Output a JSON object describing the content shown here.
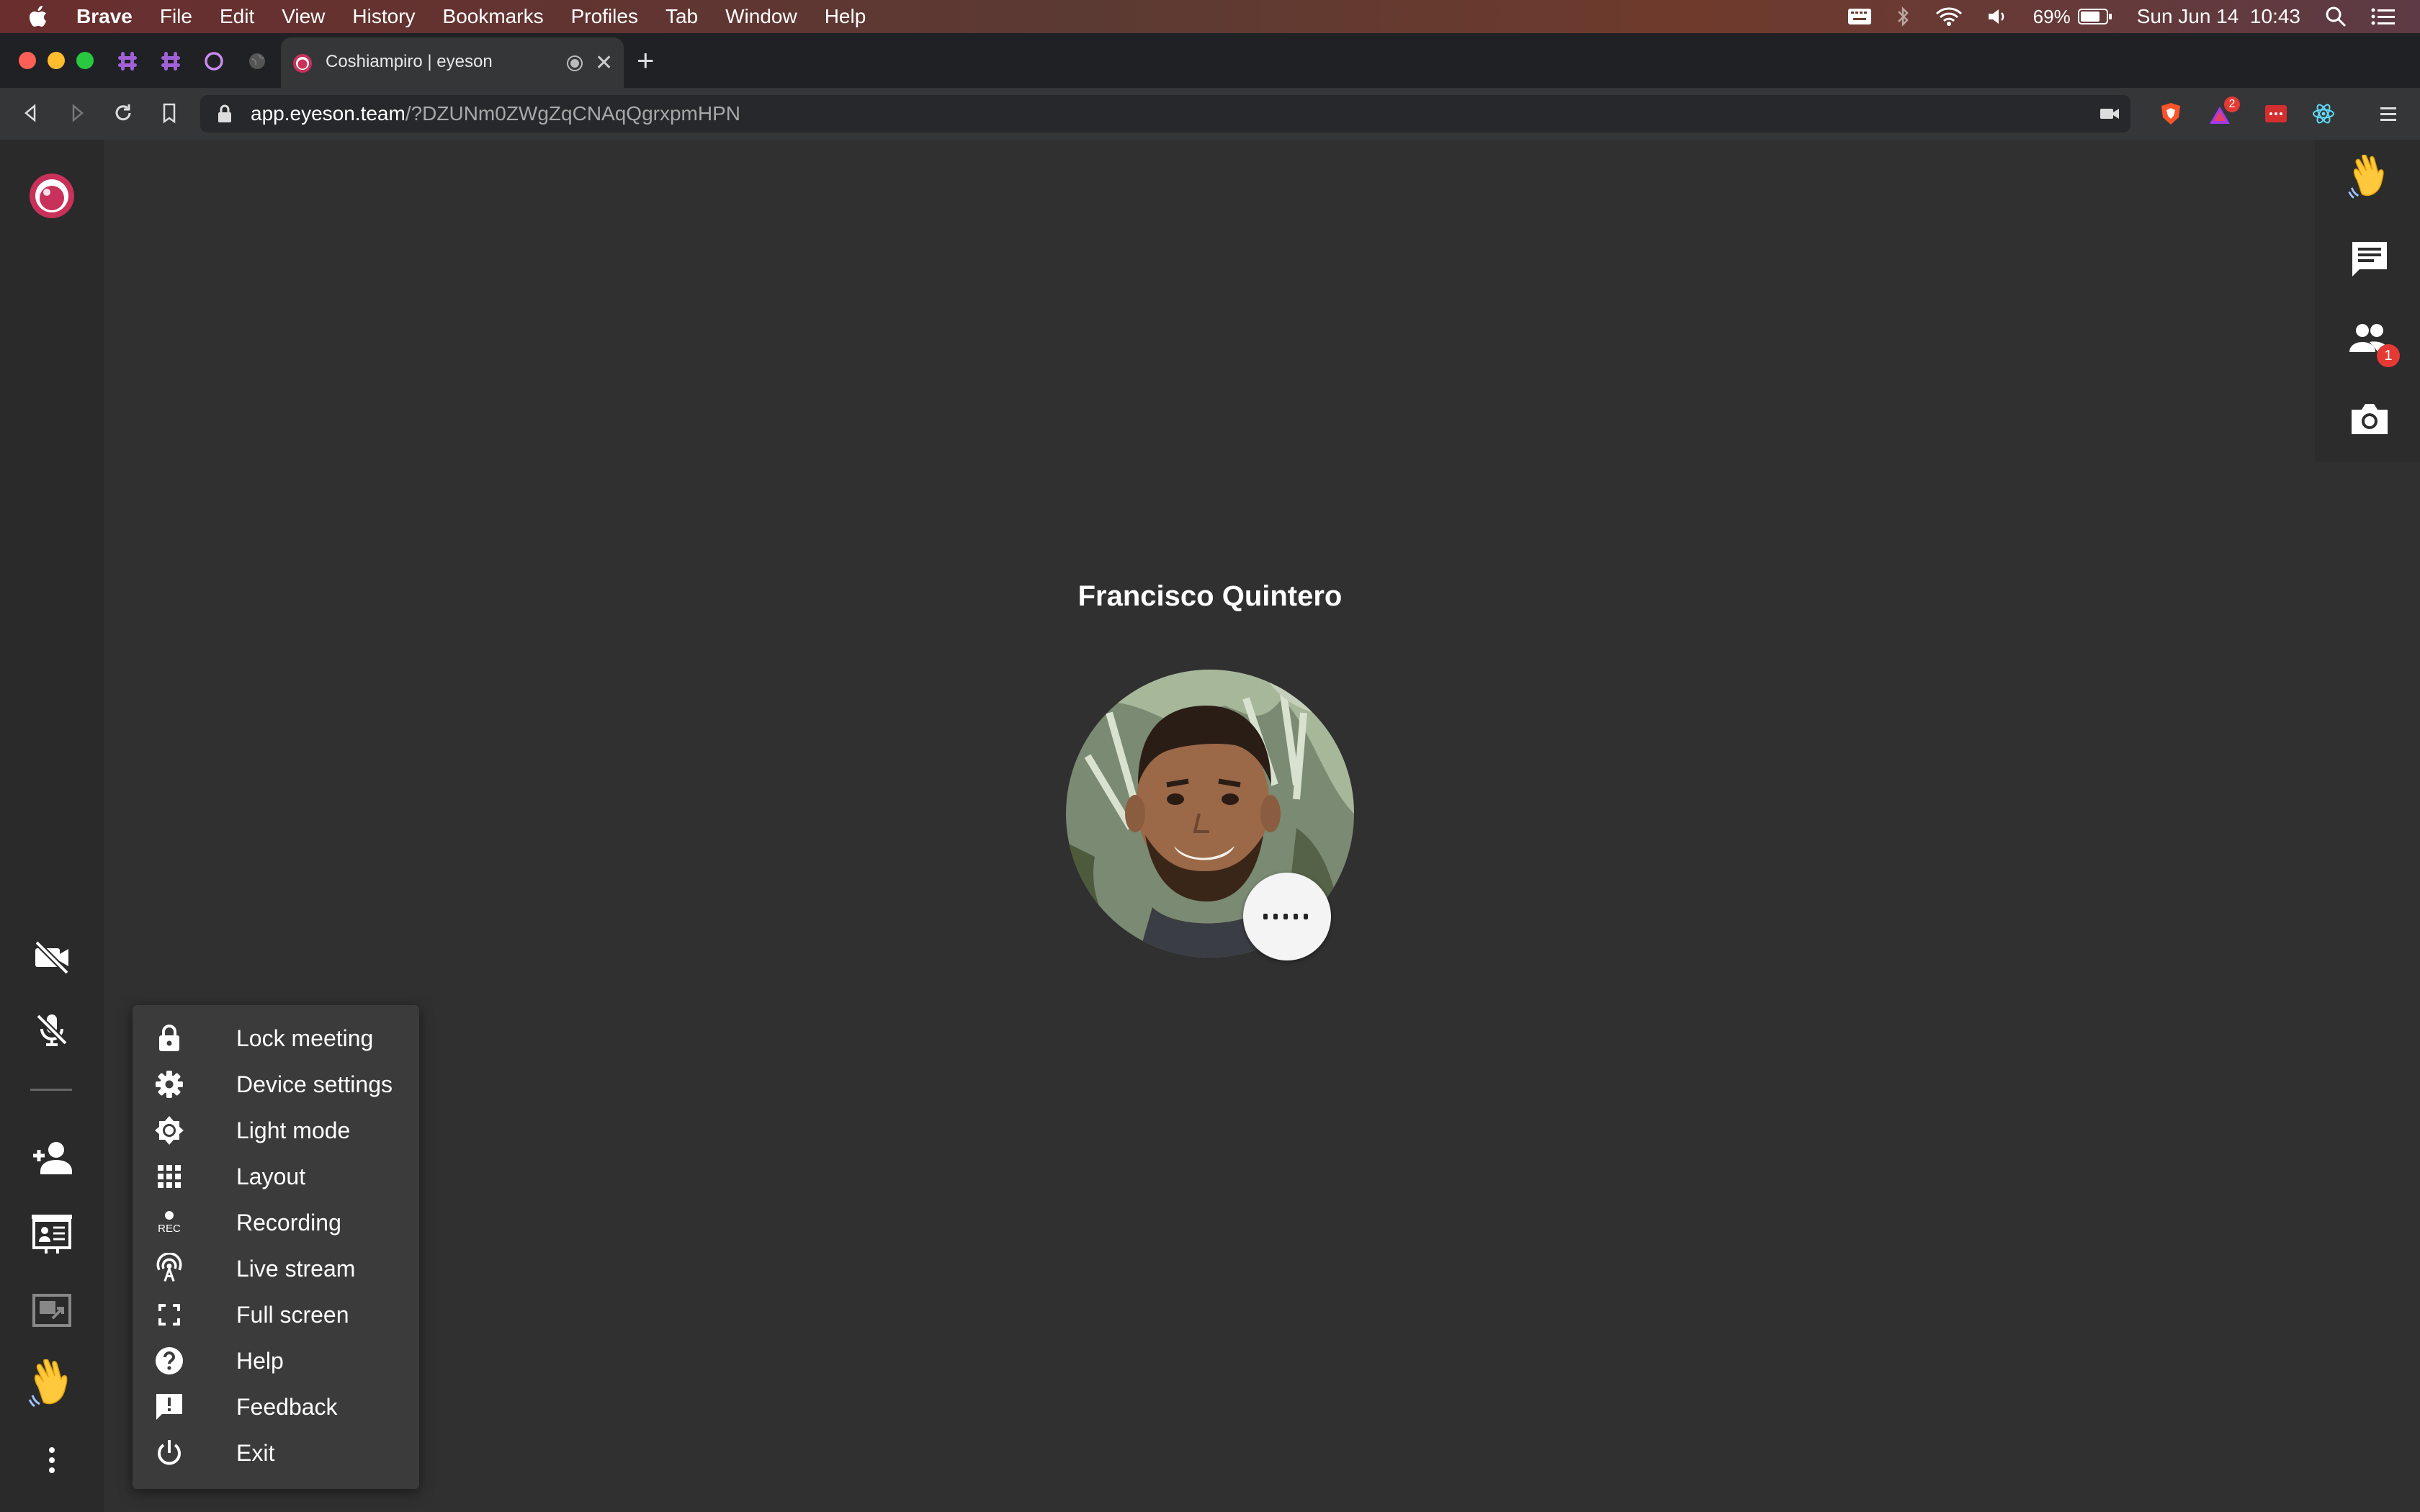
{
  "menubar": {
    "app_name": "Brave",
    "items": [
      "File",
      "Edit",
      "View",
      "History",
      "Bookmarks",
      "Profiles",
      "Tab",
      "Window",
      "Help"
    ],
    "battery": "69%",
    "datetime": "Sun Jun 14  10:43"
  },
  "browser": {
    "tab_title": "Coshiampiro | eyeson",
    "url_host": "app.eyeson.team",
    "url_path": "/?DZUNm0ZWgZqCNAqQgrxpmHPN",
    "brave_rewards_badge": "2"
  },
  "stage": {
    "participant_name": "Francisco Quintero",
    "participants_badge": "1"
  },
  "menu": {
    "items": [
      {
        "label": "Lock meeting",
        "icon": "lock-icon"
      },
      {
        "label": "Device settings",
        "icon": "gear-icon"
      },
      {
        "label": "Light mode",
        "icon": "brightness-icon"
      },
      {
        "label": "Layout",
        "icon": "grid-icon"
      },
      {
        "label": "Recording",
        "icon": "rec-icon",
        "icon_text": "REC"
      },
      {
        "label": "Live stream",
        "icon": "broadcast-icon"
      },
      {
        "label": "Full screen",
        "icon": "fullscreen-icon"
      },
      {
        "label": "Help",
        "icon": "help-icon"
      },
      {
        "label": "Feedback",
        "icon": "feedback-icon"
      },
      {
        "label": "Exit",
        "icon": "power-icon"
      }
    ]
  },
  "colors": {
    "brand": "#c8315a",
    "background": "#303030",
    "menu_bg": "#3b3b3b",
    "badge": "#e53935"
  }
}
